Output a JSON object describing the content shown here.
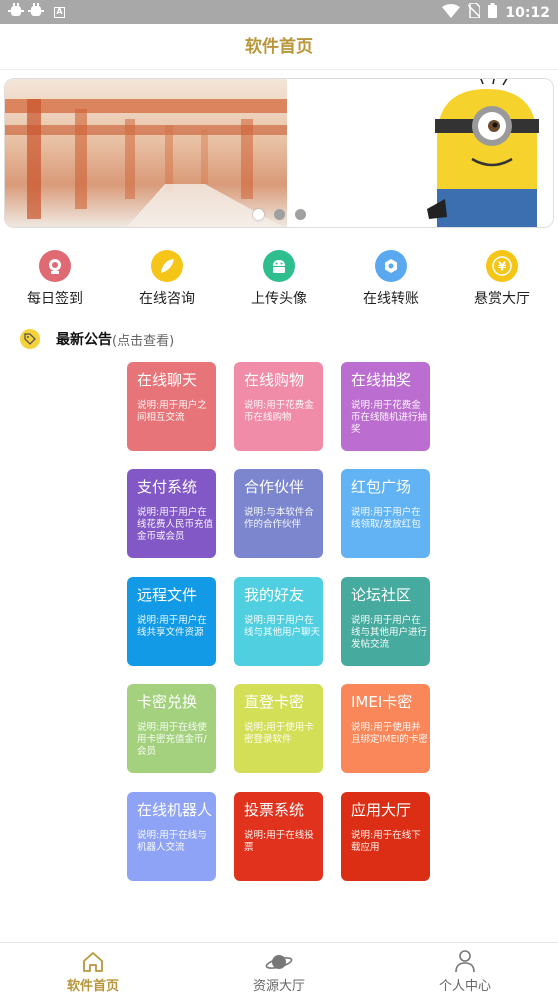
{
  "status_bar": {
    "time": "10:12",
    "left_icons": [
      "bug-icon",
      "bug-icon",
      "a-icon"
    ],
    "right_icons": [
      "wifi-icon",
      "no-sim-icon",
      "battery-icon"
    ]
  },
  "title": "软件首页",
  "banner": {
    "page_count": 3,
    "active_index": 0
  },
  "quick_actions": [
    {
      "label": "每日签到",
      "icon": "signin-icon",
      "color": "#e06a74"
    },
    {
      "label": "在线咨询",
      "icon": "leaf-icon",
      "color": "#f5c518"
    },
    {
      "label": "上传头像",
      "icon": "android-icon",
      "color": "#2fbf8f"
    },
    {
      "label": "在线转账",
      "icon": "transfer-icon",
      "color": "#5aa9f0"
    },
    {
      "label": "悬赏大厅",
      "icon": "yen-icon",
      "color": "#f5c518"
    }
  ],
  "notice": {
    "title": "最新公告",
    "subtitle": "(点击查看)"
  },
  "cards": [
    {
      "title": "在线聊天",
      "desc": "说明:用于用户之间相互交流",
      "color": "#e77478"
    },
    {
      "title": "在线购物",
      "desc": "说明:用于花费金币在线购物",
      "color": "#f08ca8"
    },
    {
      "title": "在线抽奖",
      "desc": "说明:用于花费金币在线随机进行抽奖",
      "color": "#bb6ecf"
    },
    {
      "title": "支付系统",
      "desc": "说明:用于用户在线花费人民币充值金币或会员",
      "color": "#8257c6"
    },
    {
      "title": "合作伙伴",
      "desc": "说明:与本软件合作的合作伙伴",
      "color": "#7b86ce"
    },
    {
      "title": "红包广场",
      "desc": "说明:用于用户在线领取/发放红包",
      "color": "#62b3f3"
    },
    {
      "title": "远程文件",
      "desc": "说明:用于用户在线共享文件资源",
      "color": "#129ae6"
    },
    {
      "title": "我的好友",
      "desc": "说明:用于用户在线与其他用户聊天",
      "color": "#4fcfe0"
    },
    {
      "title": "论坛社区",
      "desc": "说明:用于用户在线与其他用户进行发帖交流",
      "color": "#46ab9e"
    },
    {
      "title": "卡密兑换",
      "desc": "说明:用于在线使用卡密充值金币/会员",
      "color": "#a3d17d"
    },
    {
      "title": "直登卡密",
      "desc": "说明:用于使用卡密登录软件",
      "color": "#d4df58"
    },
    {
      "title": "IMEI卡密",
      "desc": "说明:用于使用并且绑定IMEI的卡密",
      "color": "#f9875a"
    },
    {
      "title": "在线机器人",
      "desc": "说明:用于在线与机器人交流",
      "color": "#8fa3f6"
    },
    {
      "title": "投票系统",
      "desc": "说明:用于在线投票",
      "color": "#e0321c"
    },
    {
      "title": "应用大厅",
      "desc": "说明:用于在线下载应用",
      "color": "#db2e14"
    }
  ],
  "tabs": [
    {
      "label": "软件首页",
      "icon": "home-icon",
      "active": true
    },
    {
      "label": "资源大厅",
      "icon": "planet-icon",
      "active": false
    },
    {
      "label": "个人中心",
      "icon": "person-icon",
      "active": false
    }
  ]
}
